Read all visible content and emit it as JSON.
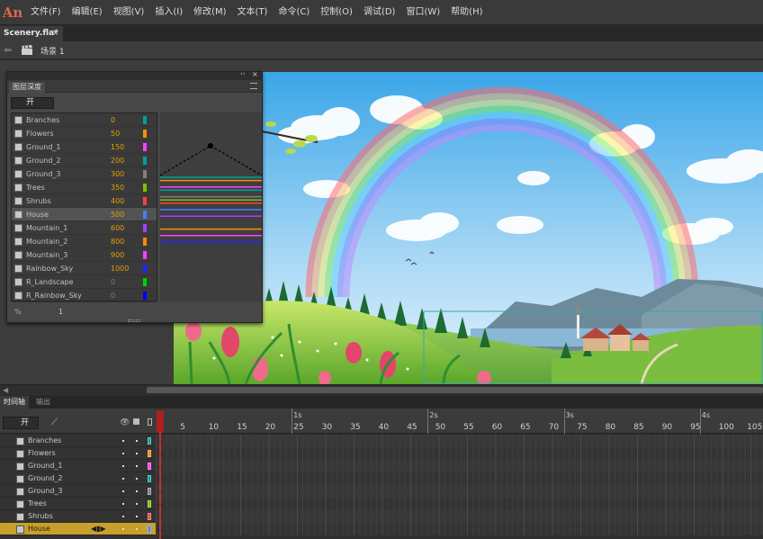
{
  "app": {
    "logo": "An"
  },
  "menu": [
    "文件(F)",
    "编辑(E)",
    "视图(V)",
    "插入(I)",
    "修改(M)",
    "文本(T)",
    "命令(C)",
    "控制(O)",
    "调试(D)",
    "窗口(W)",
    "帮助(H)"
  ],
  "document": {
    "tab_title": "Scenery.fla*",
    "close": "×"
  },
  "scene": {
    "label": "场景 1"
  },
  "layer_depth_panel": {
    "tab": "图层深度",
    "collapse": "‹‹",
    "close": "×",
    "toggle_label": "开",
    "footer_value": "1",
    "layers": [
      {
        "name": "Branches",
        "depth": "0",
        "color": "#00a0a0"
      },
      {
        "name": "Flowers",
        "depth": "50",
        "color": "#ff8c00"
      },
      {
        "name": "Ground_1",
        "depth": "150",
        "color": "#ff40ff"
      },
      {
        "name": "Ground_2",
        "depth": "200",
        "color": "#00a0a0"
      },
      {
        "name": "Ground_3",
        "depth": "300",
        "color": "#808080"
      },
      {
        "name": "Trees",
        "depth": "350",
        "color": "#80c000"
      },
      {
        "name": "Shrubs",
        "depth": "400",
        "color": "#ff4040"
      },
      {
        "name": "House",
        "depth": "500",
        "color": "#4080ff"
      },
      {
        "name": "Mountain_1",
        "depth": "600",
        "color": "#a040ff"
      },
      {
        "name": "Mountain_2",
        "depth": "800",
        "color": "#ff8c00"
      },
      {
        "name": "Mountain_3",
        "depth": "900",
        "color": "#ff40ff"
      },
      {
        "name": "Rainbow_Sky",
        "depth": "1000",
        "color": "#2020ff"
      },
      {
        "name": "R_Landscape",
        "depth": "0",
        "color": "#00d000"
      },
      {
        "name": "R_Rainbow_Sky",
        "depth": "0",
        "color": "#0000ff"
      }
    ]
  },
  "timeline": {
    "tabs": [
      "时间轴",
      "输出"
    ],
    "toggle_label": "开",
    "current_frame": "1",
    "ruler_numbers": [
      "5",
      "10",
      "15",
      "20",
      "25",
      "30",
      "35",
      "40",
      "45",
      "50",
      "55",
      "60",
      "65",
      "70",
      "75",
      "80",
      "85",
      "90",
      "95",
      "100",
      "105"
    ],
    "seconds": [
      "1s",
      "2s",
      "3s",
      "4s"
    ],
    "layers": [
      {
        "name": "Branches",
        "color": "#00a0a0"
      },
      {
        "name": "Flowers",
        "color": "#ff8c00"
      },
      {
        "name": "Ground_1",
        "color": "#ff40ff"
      },
      {
        "name": "Ground_2",
        "color": "#00a0a0"
      },
      {
        "name": "Ground_3",
        "color": "#808080"
      },
      {
        "name": "Trees",
        "color": "#80c000"
      },
      {
        "name": "Shrubs",
        "color": "#ff4040"
      },
      {
        "name": "House",
        "color": "#4080ff",
        "selected": true
      }
    ]
  }
}
